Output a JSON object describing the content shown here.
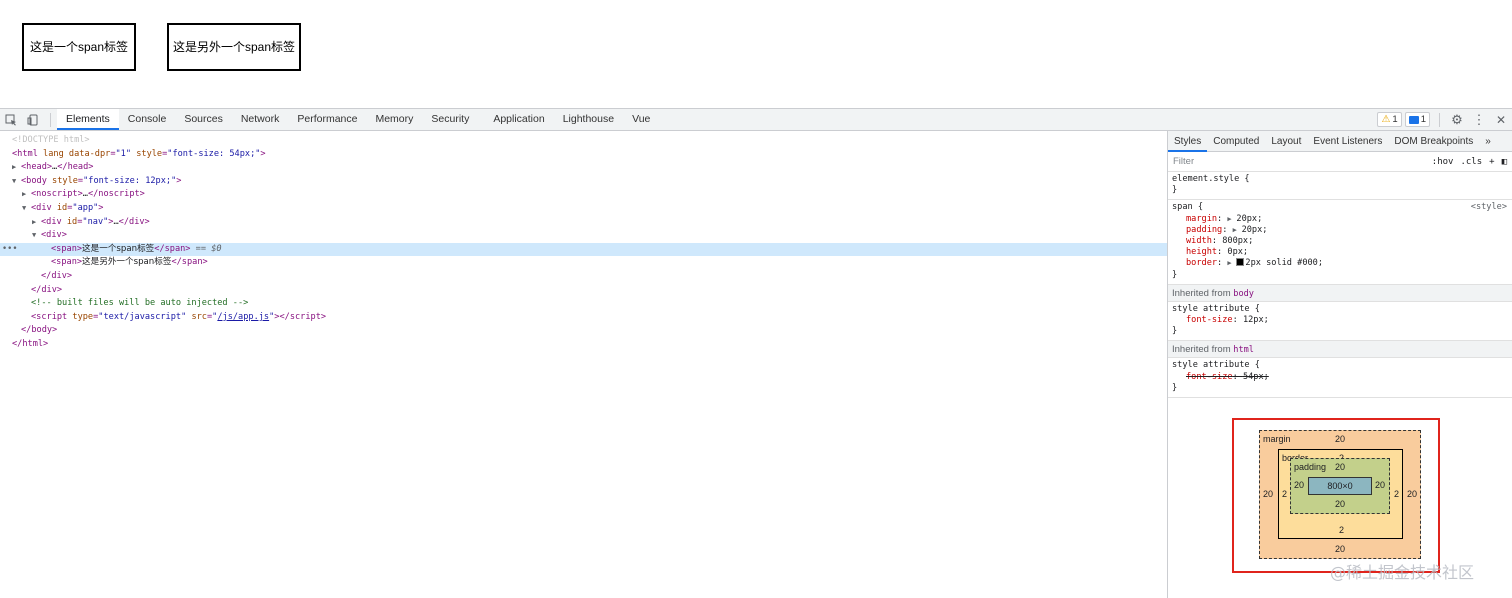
{
  "preview": {
    "span1": "这是一个span标签",
    "span2": "这是另外一个span标签"
  },
  "toolbar": {
    "tabs": [
      "Elements",
      "Console",
      "Sources",
      "Network",
      "Performance",
      "Memory",
      "Security",
      "Application",
      "Lighthouse",
      "Vue"
    ],
    "warnings_count": "1",
    "messages_count": "1"
  },
  "dom": {
    "doctype": "<!DOCTYPE html>",
    "html_open": "<html lang data-dpr=\"1\" style=\"font-size: 54px;\">",
    "head": "<head>…</head>",
    "body_open": "<body style=\"font-size: 12px;\">",
    "noscript": "<noscript>…</noscript>",
    "div_app": "<div id=\"app\">",
    "div_nav": "<div id=\"nav\">…</div>",
    "div_open": "<div>",
    "span1_text": "这是一个span标签",
    "selected_marker": "== $0",
    "span2_text": "这是另外一个span标签",
    "div_close": "</div>",
    "div_close2": "</div>",
    "comment": "<!-- built files will be auto injected -->",
    "script_src": "/js/app.js",
    "body_close": "</body>",
    "html_close": "</html>"
  },
  "styles": {
    "tabs": [
      "Styles",
      "Computed",
      "Layout",
      "Event Listeners",
      "DOM Breakpoints"
    ],
    "filter_placeholder": "Filter",
    "hov": ":hov",
    "cls": ".cls",
    "element_style": "element.style {",
    "span_selector": "span {",
    "span_source": "<style>",
    "span_props": [
      {
        "name": "margin",
        "value": "20px;"
      },
      {
        "name": "padding",
        "value": "20px;"
      },
      {
        "name": "width",
        "value": "800px;"
      },
      {
        "name": "height",
        "value": "0px;"
      },
      {
        "name": "border",
        "value": "2px solid #000;"
      }
    ],
    "inherited_body_label": "Inherited from",
    "inherited_body_tag": "body",
    "style_attr": "style attribute {",
    "body_prop": {
      "name": "font-size",
      "value": "12px;"
    },
    "inherited_html_label": "Inherited from",
    "inherited_html_tag": "html",
    "html_prop": {
      "name": "font-size",
      "value": "54px;"
    }
  },
  "box_model": {
    "margin_label": "margin",
    "margin_top": "20",
    "margin_right": "20",
    "margin_bottom": "20",
    "margin_left": "20",
    "border_label": "border",
    "border_top": "2",
    "border_right": "2",
    "border_bottom": "2",
    "border_left": "2",
    "padding_label": "padding",
    "padding_top": "20",
    "padding_right": "20",
    "padding_bottom": "20",
    "padding_left": "20",
    "content": "800×0"
  },
  "watermark": "@稀土掘金技术社区"
}
